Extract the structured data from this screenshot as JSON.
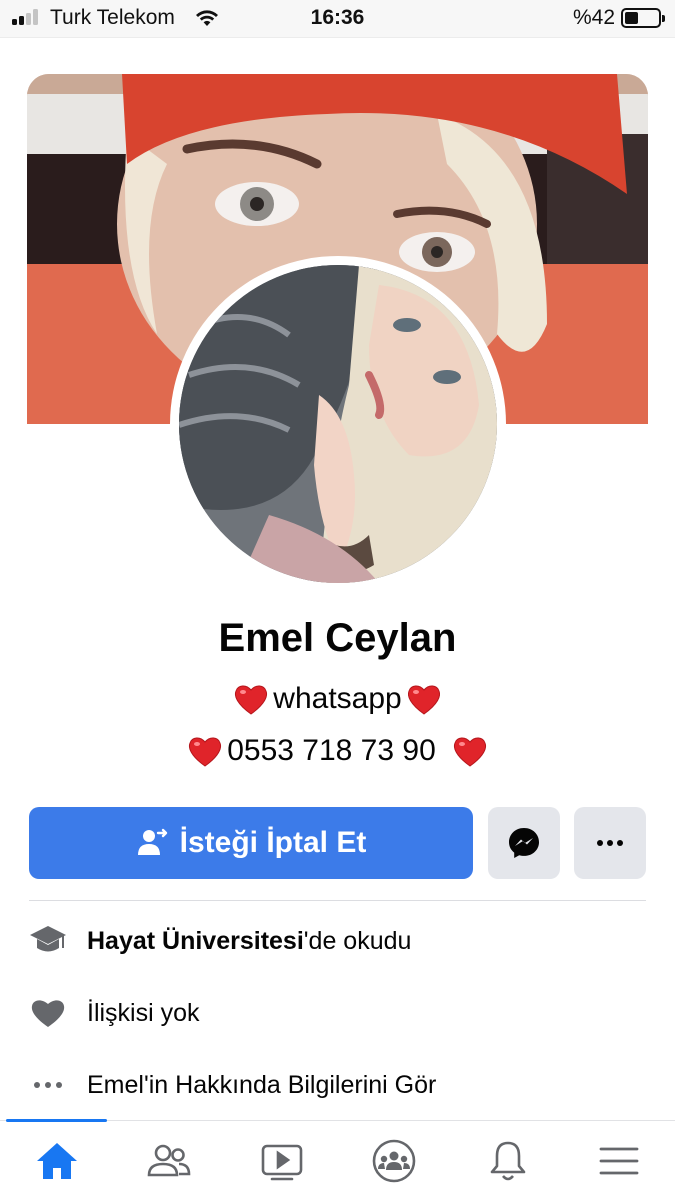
{
  "status_bar": {
    "carrier": "Turk Telekom",
    "time": "16:36",
    "battery_percent_label": "%42",
    "battery_level": 0.42,
    "signal_bars_active": 2,
    "signal_bars_total": 4
  },
  "profile": {
    "name": "Emel Ceylan",
    "bio": {
      "line1_text": "whatsapp",
      "line2_text": "0553 718 73 90"
    }
  },
  "actions": {
    "primary_label": "İsteği İptal Et",
    "messenger_icon": "messenger-icon",
    "more_icon": "more-icon"
  },
  "info": {
    "education_bold": "Hayat Üniversitesi",
    "education_suffix": "'de okudu",
    "relationship": "İlişkisi yok",
    "see_about": "Emel'in Hakkında Bilgilerini Gör"
  },
  "bottom_nav": {
    "items": [
      "home-icon",
      "friends-icon",
      "watch-icon",
      "groups-icon",
      "notifications-icon",
      "menu-icon"
    ],
    "active": "home-icon"
  },
  "colors": {
    "accent": "#3c7be9",
    "nav_active": "#1877f2",
    "heart": "#e0242a",
    "secondary_button": "#e4e6eb",
    "icon_gray": "#65676b"
  }
}
